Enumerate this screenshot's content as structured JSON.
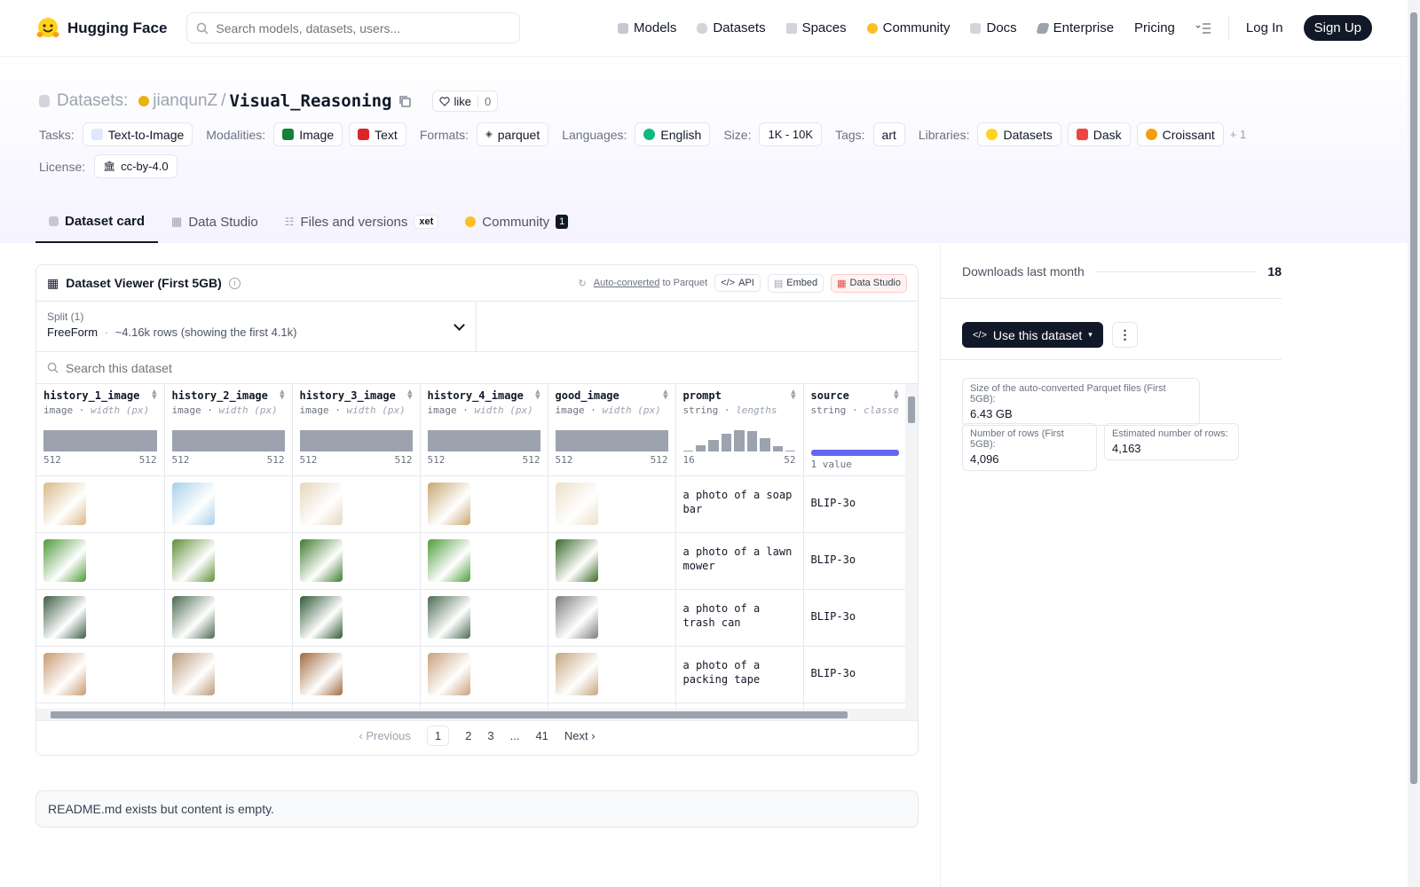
{
  "nav": {
    "brand": "Hugging Face",
    "search_placeholder": "Search models, datasets, users...",
    "items": [
      "Models",
      "Datasets",
      "Spaces",
      "Community",
      "Docs",
      "Enterprise",
      "Pricing"
    ],
    "login": "Log In",
    "signup": "Sign Up"
  },
  "dataset": {
    "prefix": "Datasets:",
    "owner": "jianqunZ",
    "slash": "/",
    "name": "Visual_Reasoning",
    "like_label": "like",
    "like_count": "0"
  },
  "tags": {
    "tasks_label": "Tasks:",
    "task": "Text-to-Image",
    "modalities_label": "Modalities:",
    "modality_1": "Image",
    "modality_2": "Text",
    "formats_label": "Formats:",
    "format": "parquet",
    "languages_label": "Languages:",
    "language": "English",
    "size_label": "Size:",
    "size": "1K - 10K",
    "tags_label": "Tags:",
    "tag": "art",
    "libraries_label": "Libraries:",
    "lib_1": "Datasets",
    "lib_2": "Dask",
    "lib_3": "Croissant",
    "more": "+ 1",
    "license_label": "License:",
    "license": "cc-by-4.0"
  },
  "tabs": {
    "card": "Dataset card",
    "studio": "Data Studio",
    "files": "Files and versions",
    "xet": "xet",
    "community": "Community",
    "community_count": "1"
  },
  "viewer": {
    "title": "Dataset Viewer (First 5GB)",
    "auto": "Auto-converted",
    "to_parquet": "to Parquet",
    "api": "API",
    "embed": "Embed",
    "data_studio": "Data Studio",
    "split_label": "Split (1)",
    "split_value": "FreeForm",
    "split_sep": "·",
    "split_rows": "~4.16k rows (showing the first 4.1k)",
    "search_placeholder": "Search this dataset"
  },
  "columns": [
    {
      "name": "history_1_image",
      "type": "image",
      "stat": "width (px)",
      "min": "512",
      "max": "512"
    },
    {
      "name": "history_2_image",
      "type": "image",
      "stat": "width (px)",
      "min": "512",
      "max": "512"
    },
    {
      "name": "history_3_image",
      "type": "image",
      "stat": "width (px)",
      "min": "512",
      "max": "512"
    },
    {
      "name": "history_4_image",
      "type": "image",
      "stat": "width (px)",
      "min": "512",
      "max": "512"
    },
    {
      "name": "good_image",
      "type": "image",
      "stat": "width (px)",
      "min": "512",
      "max": "512"
    },
    {
      "name": "prompt",
      "type": "string",
      "stat": "lengths",
      "min": "16",
      "max": "52"
    },
    {
      "name": "source",
      "type": "string",
      "stat": "classes",
      "min": "1 value",
      "max": ""
    }
  ],
  "prompt_length_histogram": [
    0.04,
    0.3,
    0.55,
    0.85,
    1.0,
    0.95,
    0.62,
    0.25,
    0.05
  ],
  "rows": [
    {
      "prompt": "a photo of a soap bar",
      "source": "BLIP-3o",
      "colors": [
        "#d9b98a",
        "#a9d0ea",
        "#e4d7bd",
        "#c8a772",
        "#ece0c8"
      ]
    },
    {
      "prompt": "a photo of a lawn mower",
      "source": "BLIP-3o",
      "colors": [
        "#4f9a3a",
        "#5e8f38",
        "#3f7b2e",
        "#4d9d3c",
        "#3a6a2a"
      ]
    },
    {
      "prompt": "a photo of a trash can",
      "source": "BLIP-3o",
      "colors": [
        "#3e5e45",
        "#4b6a4f",
        "#2f5a37",
        "#4c6b52",
        "#7b7d7e"
      ]
    },
    {
      "prompt": "a photo of a packing tape",
      "source": "BLIP-3o",
      "colors": [
        "#c89a6e",
        "#b99a7a",
        "#a06a3e",
        "#caa07a",
        "#c4a67d"
      ]
    }
  ],
  "pagination": {
    "prev": "Previous",
    "pages": [
      "1",
      "2",
      "3",
      "...",
      "41"
    ],
    "next": "Next"
  },
  "readme": "README.md exists but content is empty.",
  "sidebar": {
    "downloads_label": "Downloads last month",
    "downloads_value": "18",
    "use_button": "Use this dataset",
    "parquet_size_label": "Size of the auto-converted Parquet files (First 5GB):",
    "parquet_size": "6.43 GB",
    "rows_label": "Number of rows (First 5GB):",
    "rows_value": "4,096",
    "est_rows_label": "Estimated number of rows:",
    "est_rows_value": "4,163"
  },
  "colors": {
    "accent": "#6366f1",
    "dark": "#111827",
    "hf_yellow": "#ffd21e"
  }
}
